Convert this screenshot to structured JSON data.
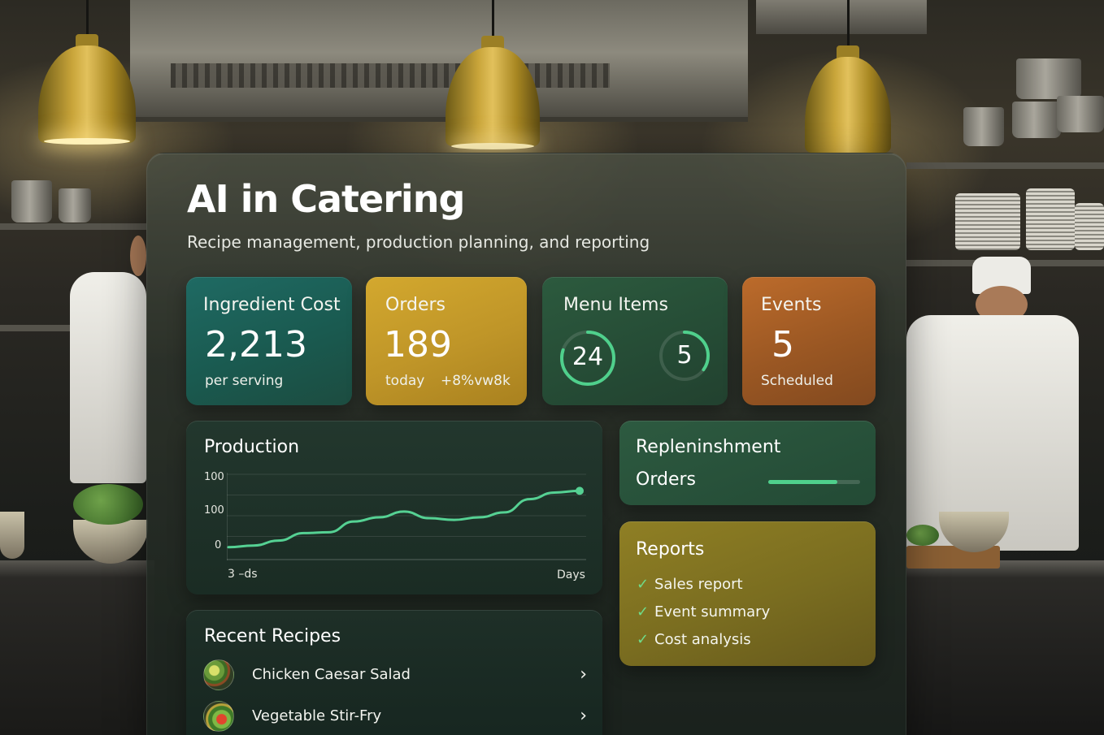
{
  "title": "AI in Catering",
  "subtitle": "Recipe management, production planning, and reporting",
  "colors": {
    "accent_green": "#4fd08c",
    "card_teal": "#1f6a63",
    "card_gold": "#c9a02b",
    "card_forest": "#2a553b",
    "card_orange": "#a95f27",
    "card_olive": "#7d7022"
  },
  "kpis": {
    "ingredient_cost": {
      "label": "Ingredient Cost",
      "value": "2,213",
      "sub": "per serving"
    },
    "orders": {
      "label": "Orders",
      "value": "189",
      "sub": "today",
      "delta": "+8%vw8k"
    },
    "menu_items": {
      "label": "Menu Items",
      "ring1": "24",
      "ring2": "5",
      "ring1_fraction": 0.8,
      "ring2_fraction": 0.35
    },
    "events": {
      "label": "Events",
      "value": "5",
      "sub": "Scheduled"
    }
  },
  "production": {
    "title": "Production",
    "chart_data": {
      "type": "line",
      "title": "Production",
      "xlabel": "Days",
      "x_start_label": "3 –ds",
      "y_tick_labels": [
        "100",
        "100",
        "0"
      ],
      "ylim": [
        0,
        100
      ],
      "grid": true,
      "series": [
        {
          "values": [
            12,
            14,
            20,
            29,
            30,
            43,
            48,
            55,
            47,
            45,
            48,
            54,
            70,
            78,
            80
          ]
        }
      ]
    }
  },
  "replenishment": {
    "title": "Repleninshment",
    "sub": "Orders",
    "progress": 0.75
  },
  "reports": {
    "title": "Reports",
    "items": [
      "Sales report",
      "Event summary",
      "Cost analysis"
    ]
  },
  "recent_recipes": {
    "title": "Recent Recipes",
    "items": [
      "Chicken Caesar Salad",
      "Vegetable Stir-Fry"
    ]
  },
  "icons": {
    "check": "check-icon",
    "chevron": "chevron-right-icon",
    "recipe_thumb": "food-thumbnail"
  }
}
